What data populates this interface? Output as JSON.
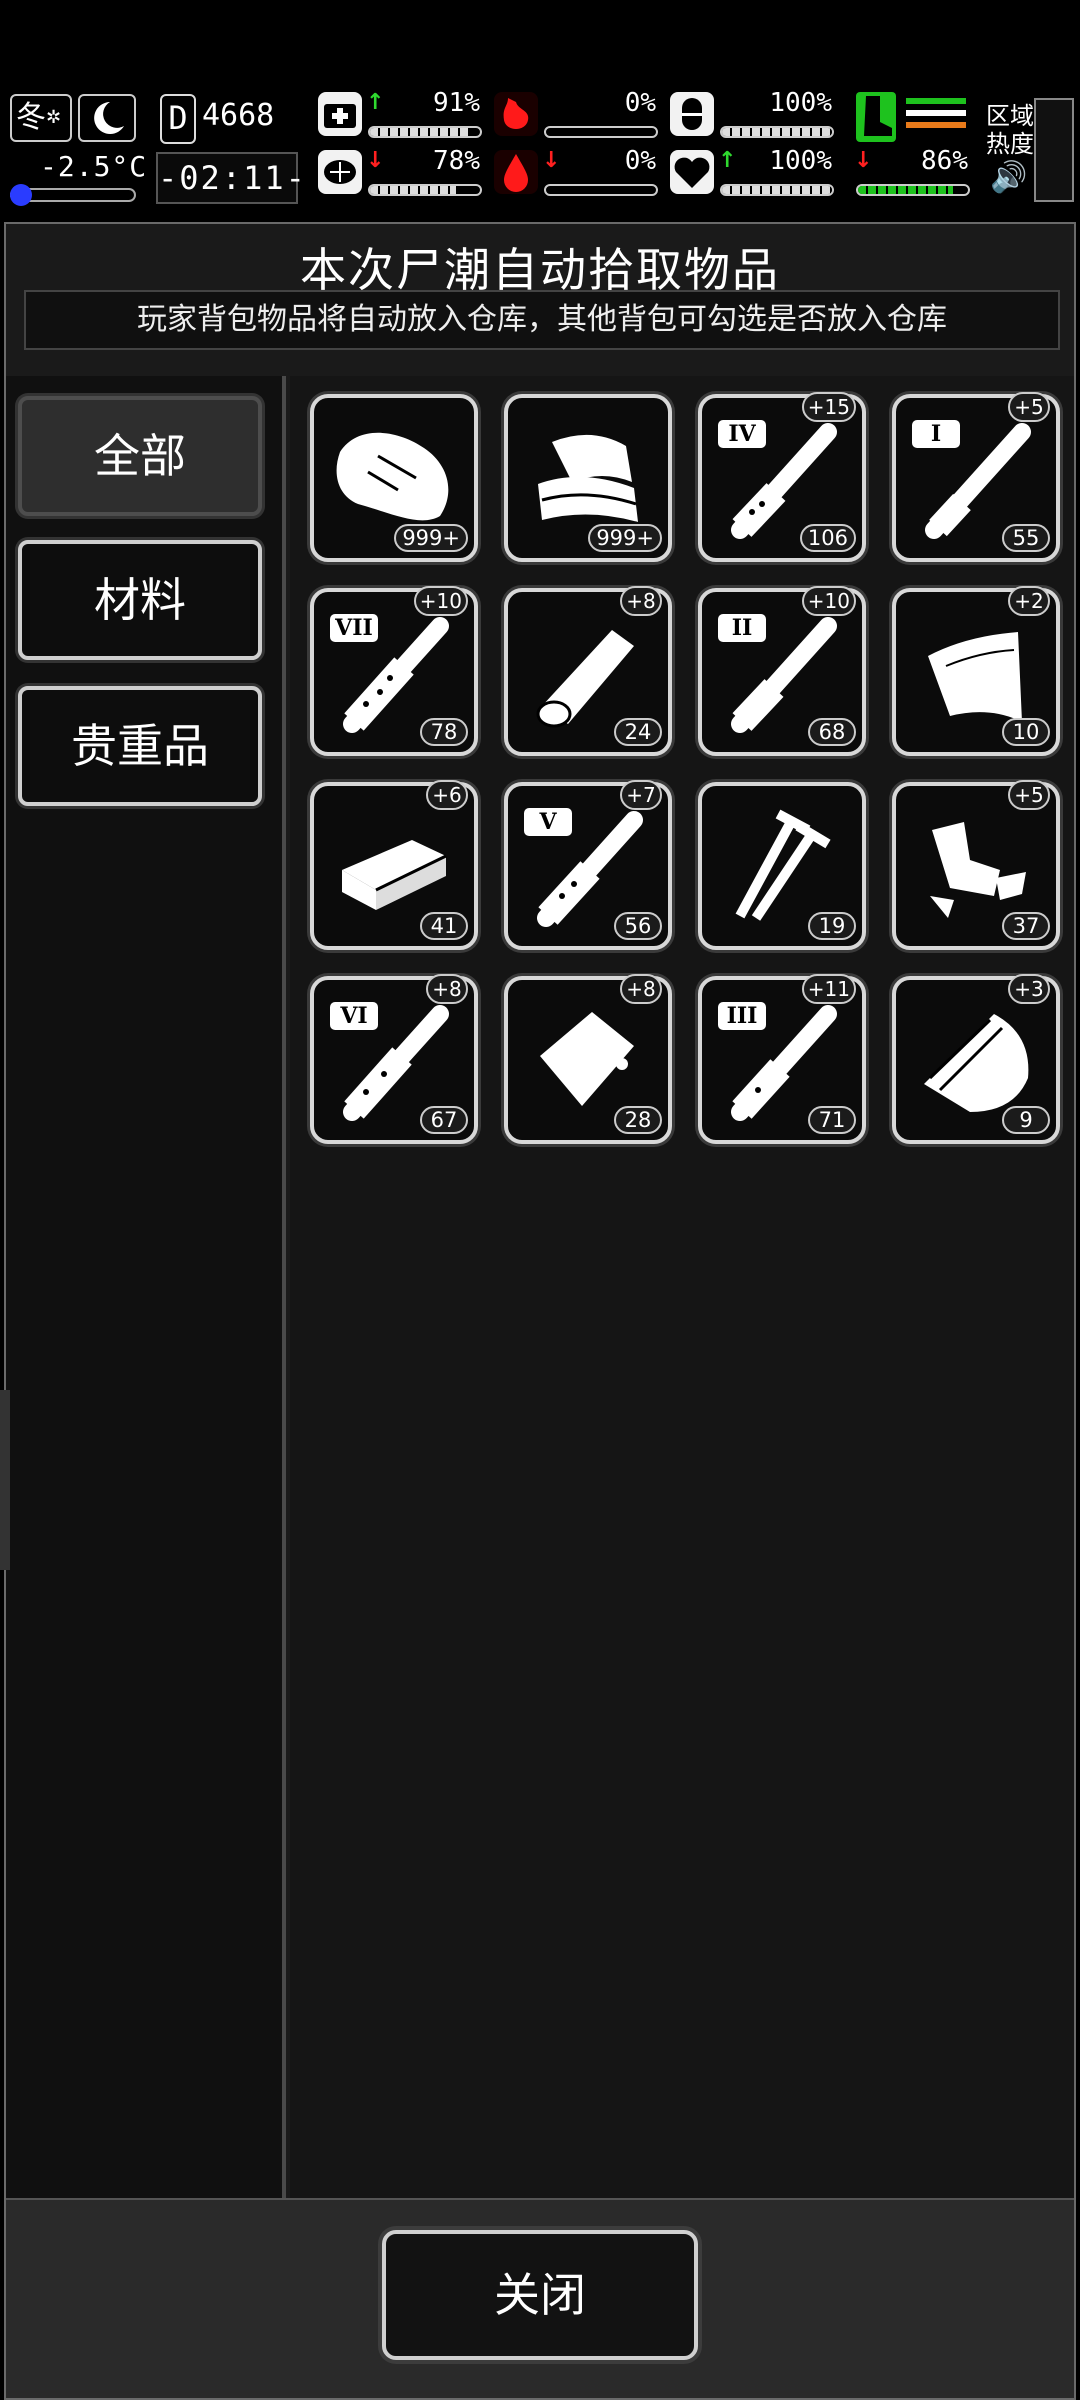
{
  "hud": {
    "season": "冬",
    "temperature": "-2.5°C",
    "day_count": "4668",
    "day_glyph": "D",
    "clock": "-02:11-",
    "stats": {
      "health": {
        "value": "91%",
        "trend": "up"
      },
      "hunger": {
        "value": "0%",
        "trend": "none"
      },
      "pill": {
        "value": "100%",
        "trend": "none"
      },
      "sanity": {
        "value": "78%",
        "trend": "down"
      },
      "blood": {
        "value": "0%",
        "trend": "down"
      },
      "heart": {
        "value": "100%",
        "trend": "up"
      },
      "stamina": {
        "value": "86%",
        "trend": "down"
      }
    },
    "zone_label_1": "区域",
    "zone_label_2": "热度"
  },
  "panel": {
    "title": "本次尸潮自动拾取物品",
    "subtitle": "玩家背包物品将自动放入仓库，其他背包可勾选是否放入仓库"
  },
  "tabs": [
    {
      "label": "全部",
      "active": true
    },
    {
      "label": "材料",
      "active": false
    },
    {
      "label": "贵重品",
      "active": false
    }
  ],
  "items": [
    {
      "icon": "raw-meat-icon",
      "badge": "",
      "count": "999+"
    },
    {
      "icon": "cloth-icon",
      "badge": "",
      "count": "999+"
    },
    {
      "icon": "syringe-icon",
      "numeral": "IV",
      "badge": "+15",
      "count": "106"
    },
    {
      "icon": "syringe-icon",
      "numeral": "I",
      "badge": "+5",
      "count": "55"
    },
    {
      "icon": "syringe-icon",
      "numeral": "VII",
      "badge": "+10",
      "count": "78"
    },
    {
      "icon": "bandage-roll-icon",
      "badge": "+8",
      "count": "24"
    },
    {
      "icon": "syringe-icon",
      "numeral": "II",
      "badge": "+10",
      "count": "68"
    },
    {
      "icon": "leather-sheet-icon",
      "badge": "+2",
      "count": "10"
    },
    {
      "icon": "ingot-bar-icon",
      "badge": "+6",
      "count": "41"
    },
    {
      "icon": "syringe-icon",
      "numeral": "V",
      "badge": "+7",
      "count": "56"
    },
    {
      "icon": "screws-icon",
      "badge": "",
      "count": "19"
    },
    {
      "icon": "scrap-parts-icon",
      "badge": "+5",
      "count": "37"
    },
    {
      "icon": "syringe-icon",
      "numeral": "VI",
      "badge": "+8",
      "count": "67"
    },
    {
      "icon": "pouch-bag-icon",
      "badge": "+8",
      "count": "28"
    },
    {
      "icon": "syringe-icon",
      "numeral": "III",
      "badge": "+11",
      "count": "71"
    },
    {
      "icon": "cut-leather-icon",
      "badge": "+3",
      "count": "9"
    }
  ],
  "footer": {
    "close_label": "关闭"
  },
  "colors": {
    "up_arrow": "#2fd92f",
    "down_arrow": "#ff2020",
    "blood": "#ff1a1a",
    "stamina": "#1ec21e",
    "cold_indicator": "#2a3cff"
  }
}
